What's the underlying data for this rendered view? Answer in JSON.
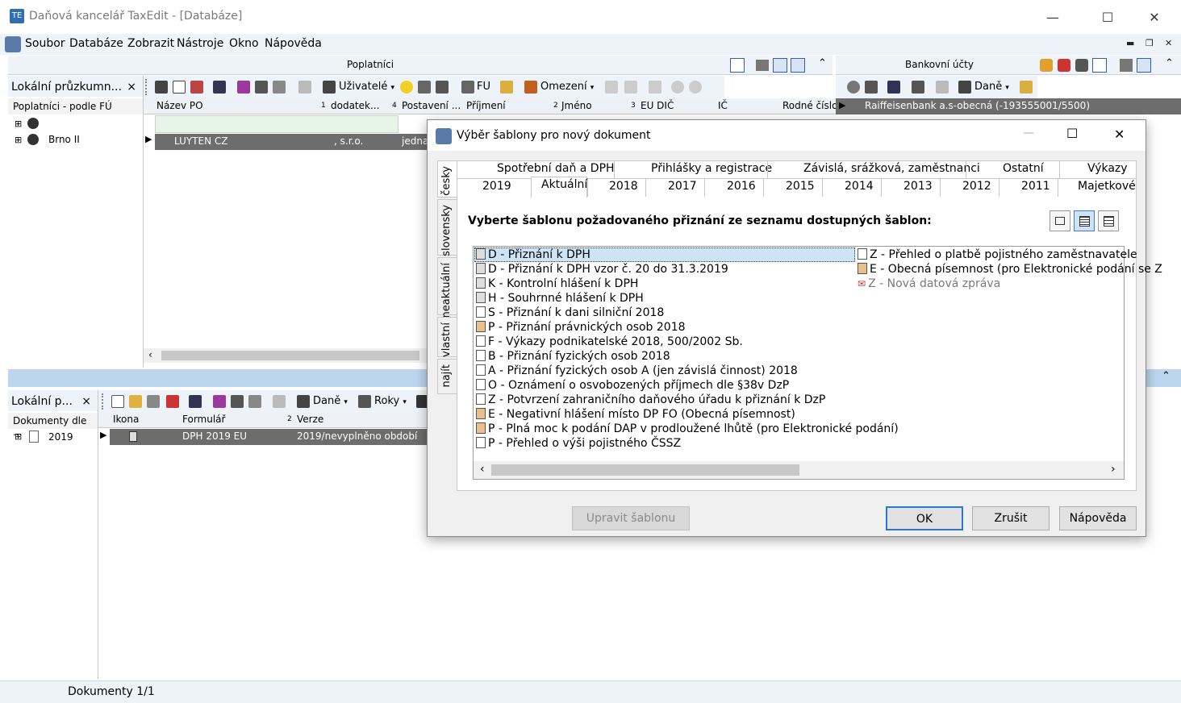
{
  "window": {
    "title": "Daňová kancelář TaxEdit - [Databáze]",
    "min": "—",
    "max": "☐",
    "close": "✕"
  },
  "menu": [
    "Soubor",
    "Databáze",
    "Zobrazit",
    "Nástroje",
    "Okno",
    "Nápověda"
  ],
  "panels": {
    "poplatnici": "Poplatníci",
    "bankovni": "Bankovní účty"
  },
  "toolbar1": {
    "uzivatele": "Uživatelé",
    "fu": "FU",
    "omezeni": "Omezení",
    "dane": "Daně"
  },
  "toolbar2": {
    "dane": "Daně",
    "roky": "Roky"
  },
  "leftpanel1": {
    "title": "Lokální průzkumn...",
    "close": "×",
    "subtitle": "Poplatníci - podle FÚ",
    "node2": "Brno II"
  },
  "grid1": {
    "headers": [
      "Název PO",
      "dodatek...",
      "Postavení ...",
      "Příjmení",
      "Jméno",
      "EU DIČ",
      "IČ",
      "Rodné číslo"
    ],
    "sort_marks": [
      "1",
      "4",
      "2",
      "3"
    ],
    "row": [
      "LUYTEN CZ",
      ", s.r.o.",
      "jedna"
    ]
  },
  "bank_row": "Raiffeisenbank a.s-obecná (-193555001/5500)",
  "leftpanel2": {
    "title": "Lokální p...",
    "close": "×",
    "subtitle": "Dokumenty dle ...",
    "node": "2019"
  },
  "grid2": {
    "headers": [
      "Ikona",
      "Formulář",
      "Verze"
    ],
    "sort_mark": "2",
    "row": [
      "DPH 2019 EU",
      "2019/nevyplněno období"
    ]
  },
  "status": "Dokumenty 1/1",
  "dialog": {
    "title": "Výběr šablony pro nový dokument",
    "min": "—",
    "max": "☐",
    "close": "✕",
    "vtabs": [
      "česky",
      "slovensky",
      "neaktuální",
      "vlastní",
      "najít"
    ],
    "tabs_row1": [
      "Spotřební daň a DPH",
      "Přihlášky a registrace",
      "Závislá, srážková, zaměstnanci",
      "Ostatní",
      "Výkazy"
    ],
    "tabs_row2": [
      "2019",
      "Aktuální",
      "2018",
      "2017",
      "2016",
      "2015",
      "2014",
      "2013",
      "2012",
      "2011",
      "Majetkové"
    ],
    "instruction": "Vyberte šablonu požadovaného přiznání ze seznamu dostupných šablon:",
    "list_col1": [
      {
        "t": "D - Přiznání k DPH",
        "c": "g"
      },
      {
        "t": "D - Přiznání k DPH vzor č. 20 do 31.3.2019",
        "c": "g"
      },
      {
        "t": "K - Kontrolní hlášení k DPH",
        "c": "g"
      },
      {
        "t": "H - Souhrnné hlášení k DPH",
        "c": "g"
      },
      {
        "t": "S - Přiznání k dani silniční 2018",
        "c": "w"
      },
      {
        "t": "P - Přiznání právnických osob 2018",
        "c": "o"
      },
      {
        "t": "F - Výkazy podnikatelské 2018, 500/2002 Sb.",
        "c": "w"
      },
      {
        "t": "B - Přiznání fyzických osob 2018",
        "c": "w"
      },
      {
        "t": "A - Přiznání fyzických osob A (jen závislá činnost) 2018",
        "c": "w"
      },
      {
        "t": "O - Oznámení o osvobozených příjmech dle §38v DzP",
        "c": "w"
      },
      {
        "t": "Z - Potvrzení zahraničního daňového úřadu k přiznání k DzP",
        "c": "w"
      },
      {
        "t": "E - Negativní hlášení místo DP FO (Obecná písemnost)",
        "c": "o"
      },
      {
        "t": "P - Plná moc k podání DAP v prodloužené lhůtě (pro Elektronické podání)",
        "c": "o"
      },
      {
        "t": "P - Přehled o výši pojistného ČSSZ",
        "c": "w"
      }
    ],
    "list_col2": [
      {
        "t": "Z - Přehled o platbě pojistného zaměstnavatele",
        "c": "w"
      },
      {
        "t": "E - Obecná písemnost (pro Elektronické podání se Z",
        "c": "o"
      },
      {
        "t": "Z - Nová datová zpráva",
        "c": "x"
      }
    ],
    "buttons": {
      "edit": "Upravit šablonu",
      "ok": "OK",
      "cancel": "Zrušit",
      "help": "Nápověda"
    }
  }
}
